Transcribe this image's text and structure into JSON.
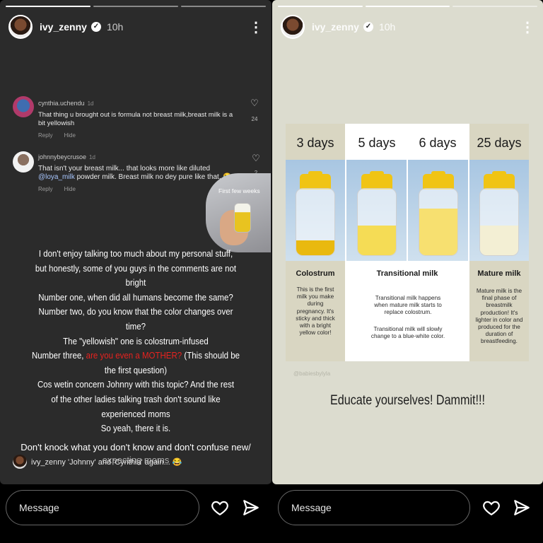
{
  "left_story": {
    "username": "ivy_zenny",
    "time": "10h",
    "comments": [
      {
        "user": "cynthia.uchendu",
        "ago": "1d",
        "text": "That thing u brought out is formula not breast milk,breast milk is a bit yellowish",
        "reply": "Reply",
        "hide": "Hide",
        "likes": "24"
      },
      {
        "user": "johnnybeycrusoe",
        "ago": "1d",
        "text_before": "That isn't your breast milk... that looks more like diluted",
        "mention": "@loya_milk",
        "text_after": "powder milk. Breast milk no dey pure like that. 😂",
        "reply": "Reply",
        "hide": "Hide",
        "likes": "2"
      }
    ],
    "inset_label": "First few weeks",
    "caption": {
      "l1": "I don't enjoy talking too much about my personal stuff,",
      "l2": "but honestly, some of you guys in the comments are not",
      "l3": "bright",
      "l4": "Number one, when did all humans become the same?",
      "l5": "Number two, do you know that the color changes over",
      "l6": "time?",
      "l7": "The \"yellowish\" one is colostrum-infused",
      "l8a": "Number three,",
      "l8b": "are you even a MOTHER?",
      "l8c": "(This should be",
      "l9": "the first question)",
      "l10": "Cos wetin concern Johnny with this topic? And the rest",
      "l11": "of the other ladies talking trash don't sound like",
      "l12": "experienced moms",
      "l13": "So yeah, there it is.",
      "l14": "Don't knock what you don't know and don't confuse new/",
      "l15": "expecting moms"
    },
    "reply_line": "ivy_zenny 'Johnny' and 'Cynthia' again... 😂",
    "message_placeholder": "Message"
  },
  "right_story": {
    "username": "ivy_zenny",
    "time": "10h",
    "infographic": {
      "days": [
        "3 days",
        "5 days",
        "6 days",
        "25 days"
      ],
      "sections": [
        {
          "title": "Colostrum",
          "text": "This is the first milk you make during pregnancy. It's sticky and thick with a bright yellow color!"
        },
        {
          "title": "Transitional milk",
          "text1": "Transitional milk happens when mature milk starts to replace colostrum.",
          "text2": "Transitional milk will slowly change to a blue-white color."
        },
        {
          "title": "Mature milk",
          "text": "Mature milk is the final phase of breastmilk production! It's lighter in color and produced for the duration of breastfeeding."
        }
      ],
      "fill_colors": [
        "#e9b90f",
        "#f5dc55",
        "#f7e070",
        "#f3efd4"
      ],
      "fill_levels": [
        0.22,
        0.45,
        0.7,
        0.45
      ]
    },
    "watermark": "@babiesbylyla",
    "headline": "Educate yourselves! Dammit!!!",
    "message_placeholder": "Message"
  }
}
